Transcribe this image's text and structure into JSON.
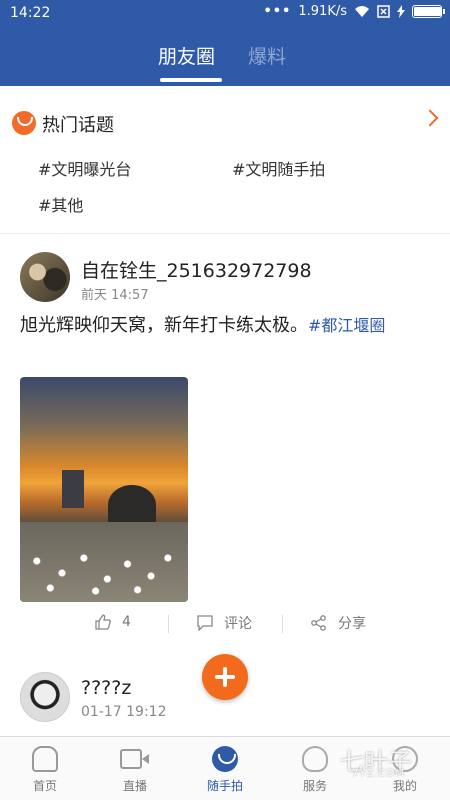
{
  "status_bar": {
    "time": "14:22",
    "dots": "•••",
    "network_speed": "1.91K/s",
    "battery_level": 0.95
  },
  "header": {
    "tabs": [
      {
        "label": "朋友圈",
        "active": true
      },
      {
        "label": "爆料",
        "active": false
      }
    ]
  },
  "hot_topics": {
    "title": "热门话题",
    "tags": [
      "#文明曝光台",
      "#文明随手拍",
      "#其他"
    ]
  },
  "posts": [
    {
      "username": "自在铨生_251632972798",
      "time": "前天 14:57",
      "text": "旭光辉映仰天窝，新年打卡练太极。",
      "tag": "#都江堰圈",
      "likes": "4",
      "comment_label": "评论",
      "share_label": "分享"
    },
    {
      "username": "????z",
      "time": "01-17 19:12"
    }
  ],
  "bottom_nav": [
    {
      "label": "首页",
      "active": false
    },
    {
      "label": "直播",
      "active": false
    },
    {
      "label": "随手拍",
      "active": true
    },
    {
      "label": "服务",
      "active": false
    },
    {
      "label": "我的",
      "active": false
    }
  ],
  "colors": {
    "primary": "#2f5aa8",
    "accent": "#f26b1d"
  },
  "watermark": {
    "main": "七叶子",
    "sub": "7YZ.COM"
  }
}
